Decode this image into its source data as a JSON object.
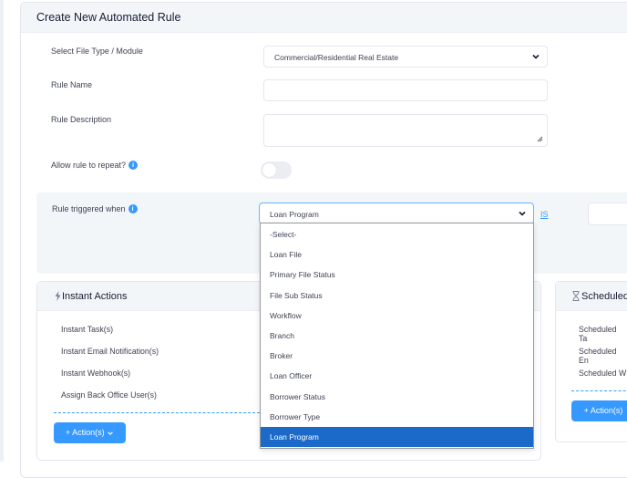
{
  "page": {
    "title": "Create New Automated Rule"
  },
  "form": {
    "file_type_label": "Select File Type / Module",
    "file_type_value": "Commercial/Residential Real Estate",
    "rule_name_label": "Rule Name",
    "rule_name_value": "",
    "rule_description_label": "Rule Description",
    "rule_description_value": "",
    "allow_repeat_label": "Allow rule to repeat?",
    "allow_repeat_on": false
  },
  "trigger": {
    "label": "Rule triggered when",
    "selected_value": "Loan Program",
    "operator_link": "IS",
    "options": [
      "-Select-",
      "Loan File",
      "Primary File Status",
      "File Sub Status",
      "Workflow",
      "Branch",
      "Broker",
      "Loan Officer",
      "Borrower Status",
      "Borrower Type",
      "Loan Program"
    ],
    "highlighted_option": "Loan Program"
  },
  "instant_actions": {
    "title": "Instant Actions",
    "items": [
      "Instant Task(s)",
      "Instant Email Notification(s)",
      "Instant Webhook(s)",
      "Assign Back Office User(s)"
    ],
    "button_label": "+ Action(s)"
  },
  "scheduled_actions": {
    "title": "Scheduled",
    "items": [
      "Scheduled Ta",
      "Scheduled En",
      "Scheduled W"
    ],
    "button_label": "+ Action(s)"
  },
  "colors": {
    "accent": "#3699ff",
    "highlight": "#1b6ac9",
    "panel_bg": "#f3f6f9"
  },
  "icons": {
    "info": "info-icon",
    "bolt": "bolt-icon",
    "hourglass": "hourglass-icon",
    "chevron": "chevron-down-icon"
  }
}
